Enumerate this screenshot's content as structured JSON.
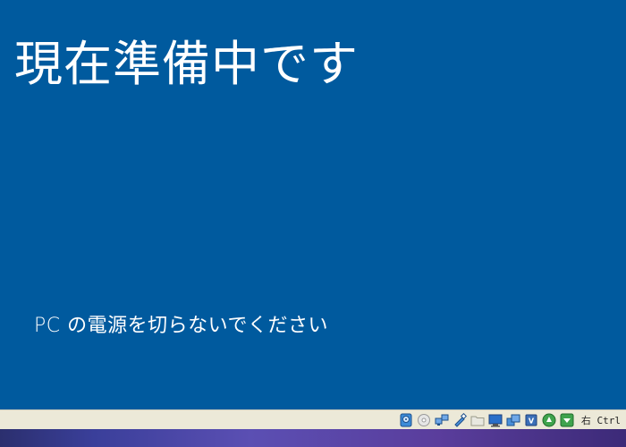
{
  "setup": {
    "title": "現在準備中です",
    "warning": "PC の電源を切らないでください"
  },
  "statusbar": {
    "host_key": "右 Ctrl",
    "icons": [
      "hard-disk-icon",
      "optical-drive-icon",
      "network-icon",
      "usb-icon",
      "shared-folder-icon",
      "display-icon",
      "video-capture-icon",
      "cpu-icon",
      "mouse-integration-icon",
      "keyboard-capture-icon"
    ]
  },
  "colors": {
    "background": "#005a9e",
    "text": "#ffffff",
    "statusbar": "#ece9d8"
  }
}
